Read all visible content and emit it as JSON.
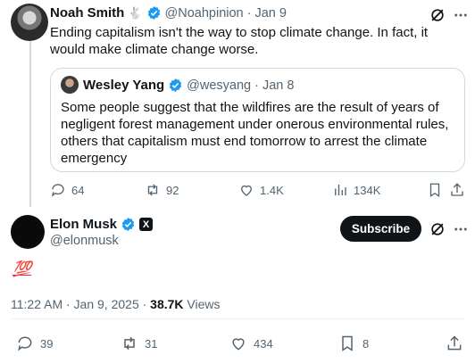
{
  "quoted_tweet": {
    "author_name": "Noah Smith",
    "author_emoji": "🐇",
    "author_handle": "@Noahpinion",
    "date": "· Jan 9",
    "text": "Ending capitalism isn't the way to stop climate change. In fact, it would make climate change worse.",
    "embedded": {
      "author_name": "Wesley Yang",
      "author_handle": "@wesyang",
      "date": "· Jan 8",
      "text": "Some people suggest that the wildfires are the result of years of negligent forest management under onerous environmental rules, others that capitalism must end tomorrow to arrest the climate emergency"
    },
    "actions": {
      "replies": "64",
      "reposts": "92",
      "likes": "1.4K",
      "views": "134K"
    }
  },
  "main_tweet": {
    "author_name": "Elon Musk",
    "author_handle": "@elonmusk",
    "subscribe_label": "Subscribe",
    "text": "💯",
    "time": "11:22 AM · Jan 9, 2025 ·",
    "views_count": "38.7K",
    "views_label": "Views",
    "actions": {
      "replies": "39",
      "reposts": "31",
      "likes": "434",
      "bookmarks": "8"
    }
  },
  "colors": {
    "verified": "#1d9bf0",
    "muted": "#536471",
    "text": "#0f1419",
    "border": "#cfd9de"
  }
}
